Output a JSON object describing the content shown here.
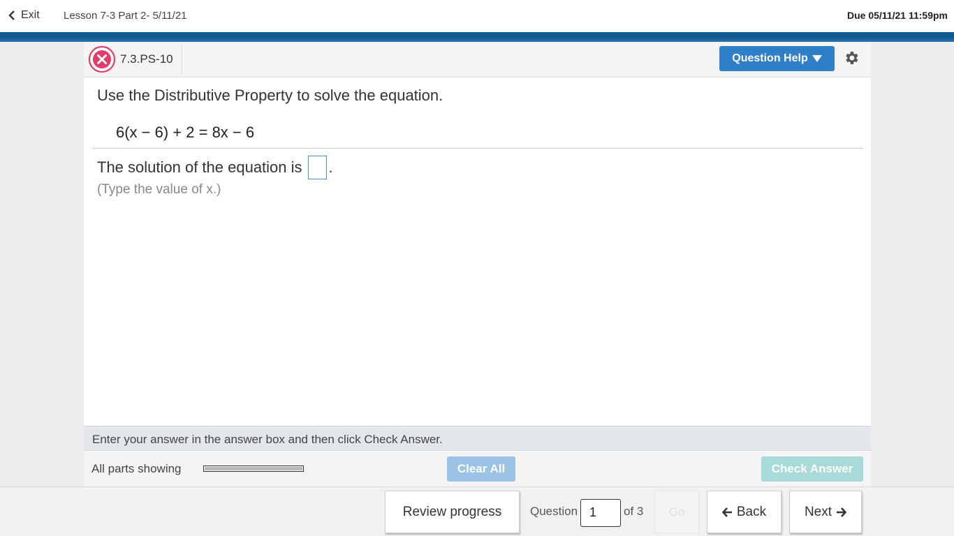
{
  "topbar": {
    "exit_label": "Exit",
    "lesson_title": "Lesson 7-3 Part 2- 5/11/21",
    "due": "Due 05/11/21 11:59pm"
  },
  "question": {
    "id": "7.3.PS-10",
    "help_label": "Question Help",
    "instruction": "Use the Distributive Property to solve the equation.",
    "equation": "6(x − 6) + 2 = 8x − 6",
    "solution_prefix": "The solution of the equation is",
    "solution_suffix": ".",
    "answer_value": "",
    "hint": "(Type the value of x.)",
    "status_message": "Enter your answer in the answer box and then click Check Answer."
  },
  "parts": {
    "label": "All parts showing",
    "progress_fraction": 1.0
  },
  "buttons": {
    "clear_all": "Clear All",
    "check_answer": "Check Answer"
  },
  "bottom_nav": {
    "review_progress": "Review progress",
    "question_label": "Question",
    "question_number": "1",
    "of_total": "of 3",
    "go": "Go",
    "back": "Back",
    "next": "Next"
  },
  "icons": {
    "exit": "chevron-left-icon",
    "status": "incorrect-x-icon",
    "help_dropdown": "caret-down-icon",
    "settings": "gear-icon",
    "back": "arrow-left-icon",
    "next": "arrow-right-icon"
  },
  "colors": {
    "brand_band": "#0f5a92",
    "help_button": "#2f7fc8",
    "incorrect": "#e23c6a",
    "clear_button": "#9ac3e6",
    "check_button": "#a7dad9"
  }
}
